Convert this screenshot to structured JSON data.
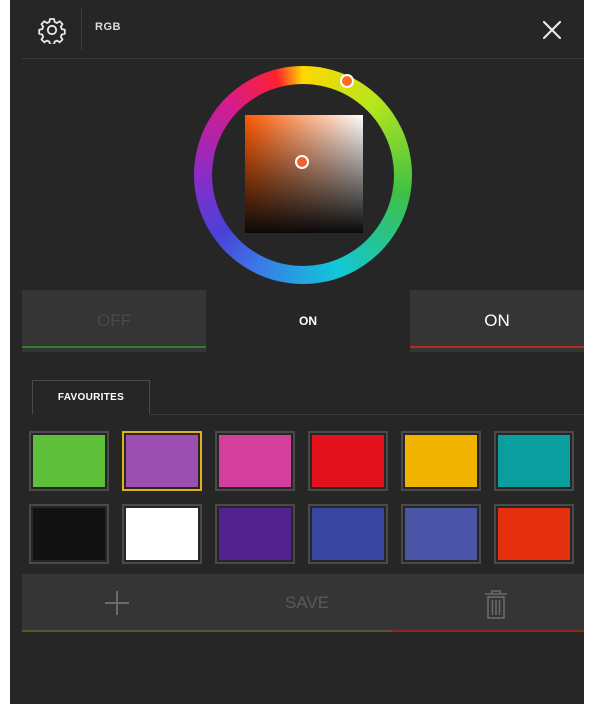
{
  "header": {
    "title": "RGB",
    "settings_icon": "gear-icon",
    "close_icon": "close-icon"
  },
  "picker": {
    "hue_color": "#ff6a20",
    "selected_color": "#f06030"
  },
  "toggles": {
    "off_label": "OFF",
    "status_label": "ON",
    "on_label": "ON",
    "off_accent": "#2f7d2f",
    "on_accent": "#b03020"
  },
  "favourites": {
    "tab_label": "FAVOURITES",
    "selected_index": 1,
    "swatches": [
      "#5dbf3a",
      "#9b4fb0",
      "#d43f9e",
      "#e3111b",
      "#f0b400",
      "#0a9e9e",
      "#121212",
      "#ffffff",
      "#52238f",
      "#3a47a0",
      "#4a55a8",
      "#e4300f"
    ]
  },
  "actions": {
    "add_icon": "plus-icon",
    "save_label": "SAVE",
    "delete_icon": "trash-icon"
  }
}
